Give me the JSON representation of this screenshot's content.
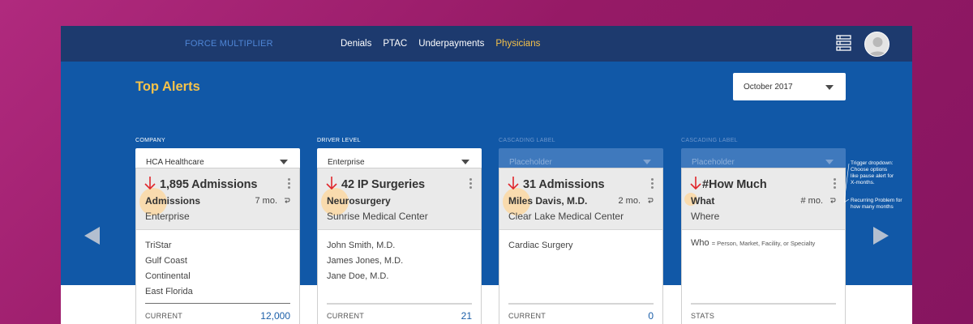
{
  "app": {
    "brand": "FORCE MULTIPLIER",
    "nav": [
      "Denials",
      "PTAC",
      "Underpayments",
      "Physicians"
    ],
    "active_nav": "Physicians",
    "menu_icon": "list-menu-icon",
    "avatar_icon": "user-avatar"
  },
  "page": {
    "title": "Top Alerts",
    "month_value": "October 2017"
  },
  "filters": [
    {
      "label": "COMPANY",
      "value": "HCA Healthcare",
      "enabled": true
    },
    {
      "label": "DRIVER LEVEL",
      "value": "Enterprise",
      "enabled": true
    },
    {
      "label": "CASCADING LABEL",
      "value": "Placeholder",
      "enabled": false
    },
    {
      "label": "CASCADING LABEL",
      "value": "Placeholder",
      "enabled": false
    }
  ],
  "cards": [
    {
      "metric": "1,895 Admissions",
      "subject": "Admissions",
      "period": "7 mo.",
      "location": "Enterprise",
      "items": [
        "TriStar",
        "Gulf Coast",
        "Continental",
        "East Florida"
      ],
      "footer_label": "CURRENT",
      "footer_value": "12,000"
    },
    {
      "metric": "42 IP Surgeries",
      "subject": "Neurosurgery",
      "period": "",
      "location": "Sunrise Medical Center",
      "items": [
        "John Smith, M.D.",
        "James Jones, M.D.",
        "Jane Doe, M.D."
      ],
      "footer_label": "CURRENT",
      "footer_value": "21"
    },
    {
      "metric": "31 Admissions",
      "subject": "Miles Davis, M.D.",
      "period": "2 mo.",
      "location": "Clear Lake Medical Center",
      "items": [
        "Cardiac Surgery"
      ],
      "footer_label": "CURRENT",
      "footer_value": "0"
    },
    {
      "metric": "#How Much",
      "subject": "What",
      "period": "# mo.",
      "location": "Where",
      "who_label": "Who",
      "who_hint": "= Person, Market, Facility, or Specialty",
      "footer_label": "STATS",
      "footer_value": ""
    }
  ],
  "annotations": {
    "trigger": [
      "Trigger dropdown:",
      "Choose options",
      "like pause alert for",
      "X-months."
    ],
    "recurring": [
      "Recurring Problem for",
      "how many months"
    ]
  },
  "colors": {
    "background": "#a3206f",
    "topbar": "#1d3a6e",
    "main": "#1158a7",
    "accent": "#f5c24a",
    "alert_arrow": "#e0262b",
    "value_blue": "#1a5ea8"
  },
  "icons": {
    "alert": "down-arrow-icon",
    "recurring": "recurring-icon",
    "card_menu": "kebab-menu-icon",
    "prev": "chevron-left-icon",
    "next": "chevron-right-icon"
  }
}
